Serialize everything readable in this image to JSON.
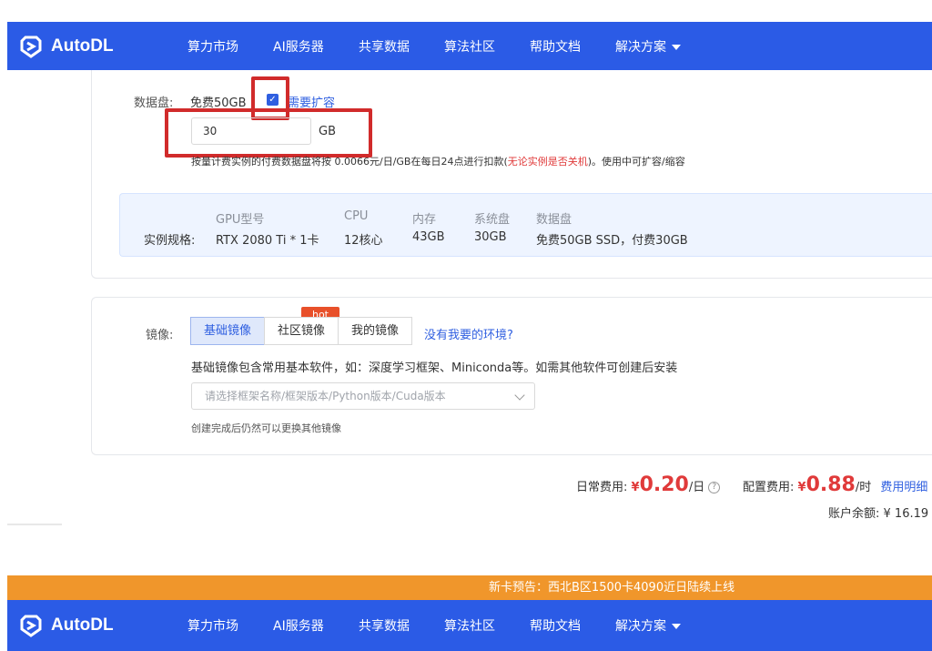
{
  "brand": {
    "name": "AutoDL",
    "color": "#2b5be6"
  },
  "nav": [
    "算力市场",
    "AI服务器",
    "共享数据",
    "算法社区",
    "帮助文档",
    "解决方案"
  ],
  "disk": {
    "label": "数据盘:",
    "free": "免费50GB",
    "checkbox_checked": true,
    "expand_link": "需要扩容",
    "value": "30",
    "unit": "GB",
    "note_prefix": "按量计费实例的付费数据盘将按 0.0066元/日/GB在每日24点进行扣款(",
    "note_warn": "无论实例是否关机",
    "note_suffix": ")。使用中可扩容/缩容"
  },
  "spec": {
    "label": "实例规格:",
    "headers": [
      "GPU型号",
      "CPU",
      "内存",
      "系统盘",
      "数据盘"
    ],
    "values": [
      "RTX 2080 Ti * 1卡",
      "12核心",
      "43GB",
      "30GB",
      "免费50GB SSD，付费30GB"
    ]
  },
  "image": {
    "label": "镜像:",
    "tabs": [
      "基础镜像",
      "社区镜像",
      "我的镜像"
    ],
    "active_tab": "基础镜像",
    "hot_badge": "hot",
    "missing_link": "没有我要的环境?",
    "description": "基础镜像包含常用基本软件，如：深度学习框架、Miniconda等。如需其他软件可创建后安装",
    "select_placeholder": "请选择框架名称/框架版本/Python版本/Cuda版本",
    "hint": "创建完成后仍然可以更换其他镜像"
  },
  "pricing": {
    "daily_label": "日常费用:",
    "daily_symbol": "¥",
    "daily_value": "0.20",
    "daily_unit": "/日",
    "config_label": "配置费用:",
    "config_symbol": "¥",
    "config_value": "0.88",
    "config_unit": "/时",
    "detail_link": "费用明细",
    "balance_label": "账户余额:",
    "balance_value": "¥ 16.19"
  },
  "banner": {
    "text": "新卡预告：西北B区1500卡4090近日陆续上线",
    "color": "#f0962b"
  }
}
